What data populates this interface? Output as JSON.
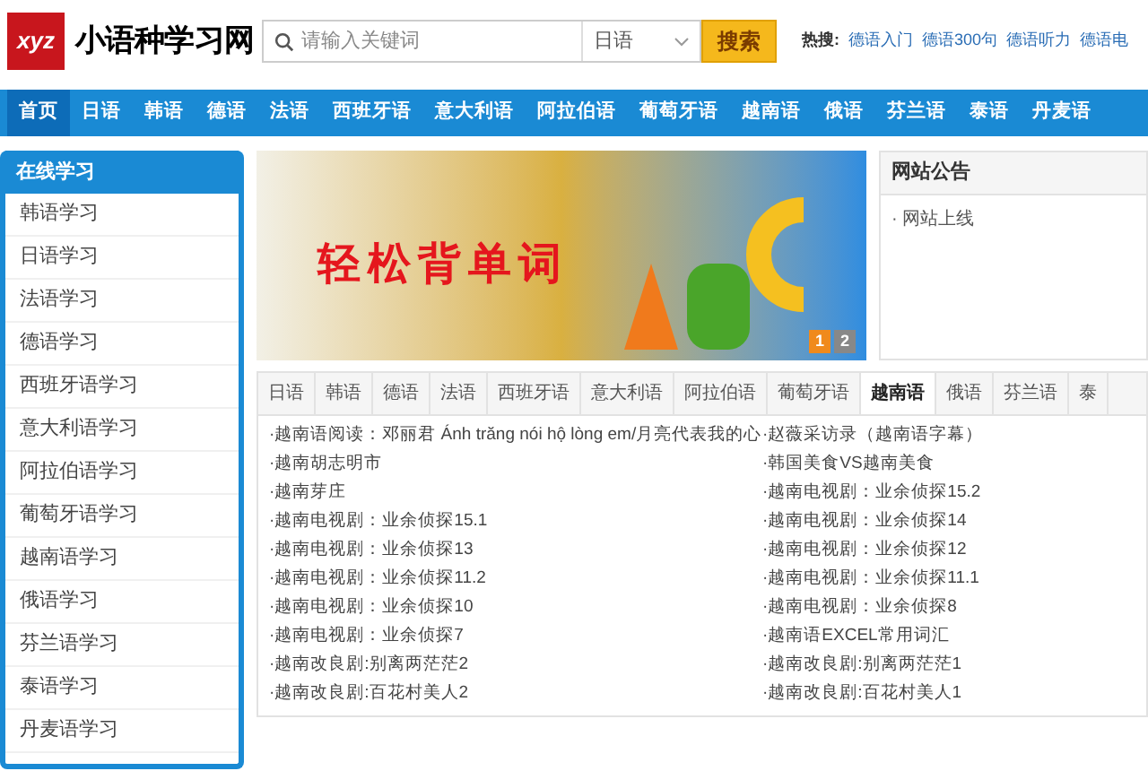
{
  "header": {
    "logo_mark": "xyz",
    "site_name": "小语种学习网",
    "search": {
      "placeholder": "请输入关键词",
      "language": "日语",
      "button": "搜索"
    },
    "hot_label": "热搜:",
    "hot_links": [
      "德语入门",
      "德语300句",
      "德语听力",
      "德语电"
    ]
  },
  "nav": [
    {
      "label": "首页",
      "selected": true
    },
    {
      "label": "日语",
      "selected": false
    },
    {
      "label": "韩语",
      "selected": false
    },
    {
      "label": "德语",
      "selected": false
    },
    {
      "label": "法语",
      "selected": false
    },
    {
      "label": "西班牙语",
      "selected": false
    },
    {
      "label": "意大利语",
      "selected": false
    },
    {
      "label": "阿拉伯语",
      "selected": false
    },
    {
      "label": "葡萄牙语",
      "selected": false
    },
    {
      "label": "越南语",
      "selected": false
    },
    {
      "label": "俄语",
      "selected": false
    },
    {
      "label": "芬兰语",
      "selected": false
    },
    {
      "label": "泰语",
      "selected": false
    },
    {
      "label": "丹麦语",
      "selected": false
    }
  ],
  "sidebar": {
    "title": "在线学习",
    "items": [
      "韩语学习",
      "日语学习",
      "法语学习",
      "德语学习",
      "西班牙语学习",
      "意大利语学习",
      "阿拉伯语学习",
      "葡萄牙语学习",
      "越南语学习",
      "俄语学习",
      "芬兰语学习",
      "泰语学习",
      "丹麦语学习"
    ]
  },
  "banner": {
    "headline": "轻松背单词",
    "pages": [
      {
        "label": "1",
        "selected": true
      },
      {
        "label": "2",
        "selected": false
      }
    ]
  },
  "notice": {
    "title": "网站公告",
    "items": [
      "· 网站上线"
    ]
  },
  "tabs": [
    {
      "label": "日语",
      "selected": false
    },
    {
      "label": "韩语",
      "selected": false
    },
    {
      "label": "德语",
      "selected": false
    },
    {
      "label": "法语",
      "selected": false
    },
    {
      "label": "西班牙语",
      "selected": false
    },
    {
      "label": "意大利语",
      "selected": false
    },
    {
      "label": "阿拉伯语",
      "selected": false
    },
    {
      "label": "葡萄牙语",
      "selected": false
    },
    {
      "label": "越南语",
      "selected": true
    },
    {
      "label": "俄语",
      "selected": false
    },
    {
      "label": "芬兰语",
      "selected": false
    },
    {
      "label": "泰",
      "selected": false
    }
  ],
  "articles": [
    [
      "·越南语阅读：邓丽君 Ánh trăng nói hộ lòng em/月亮代表我的心",
      "·赵薇采访录（越南语字幕）"
    ],
    [
      "·越南胡志明市",
      "·韩国美食VS越南美食"
    ],
    [
      "·越南芽庄",
      "·越南电视剧：业余侦探15.2"
    ],
    [
      "·越南电视剧：业余侦探15.1",
      "·越南电视剧：业余侦探14"
    ],
    [
      "·越南电视剧：业余侦探13",
      "·越南电视剧：业余侦探12"
    ],
    [
      "·越南电视剧：业余侦探11.2",
      "·越南电视剧：业余侦探11.1"
    ],
    [
      "·越南电视剧：业余侦探10",
      "·越南电视剧：业余侦探8"
    ],
    [
      "·越南电视剧：业余侦探7",
      "·越南语EXCEL常用词汇"
    ],
    [
      "·越南改良剧:别离两茫茫2",
      "·越南改良剧:别离两茫茫1"
    ],
    [
      "·越南改良剧:百花村美人2",
      "·越南改良剧:百花村美人1"
    ]
  ]
}
